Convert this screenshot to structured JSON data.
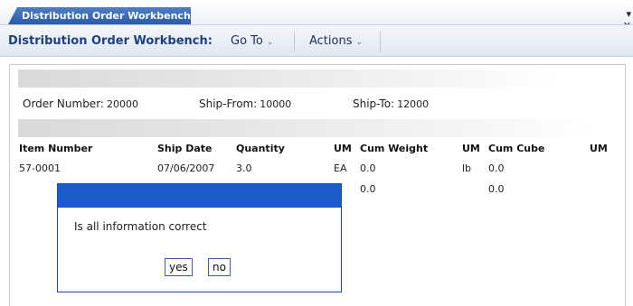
{
  "tab": {
    "label": "Distribution Order Workbench",
    "controls": "▾ ✕"
  },
  "toolbar": {
    "title": "Distribution Order Workbench:",
    "menus": [
      {
        "label": "Go To",
        "icon": "chevron-down-icon"
      },
      {
        "label": "Actions",
        "icon": "chevron-down-icon"
      }
    ]
  },
  "order": {
    "number_label": "Order Number:",
    "number_value": "20000",
    "ship_from_label": "Ship-From:",
    "ship_from_value": "10000",
    "ship_to_label": "Ship-To:",
    "ship_to_value": "12000"
  },
  "table": {
    "columns": [
      "Item Number",
      "Ship Date",
      "Quantity",
      "UM",
      "Cum Weight",
      "UM",
      "Cum Cube",
      "UM"
    ],
    "rows": [
      [
        "57-0001",
        "07/06/2007",
        "3.0",
        "EA",
        "0.0",
        "lb",
        "0.0",
        ""
      ],
      [
        "",
        "",
        "",
        "",
        "0.0",
        "",
        "0.0",
        ""
      ]
    ]
  },
  "dialog": {
    "message": "Is all information correct",
    "yes_label": "yes",
    "no_label": "no"
  },
  "colors": {
    "tab": "#2b5aa8",
    "toolbar_title": "#1f3f84",
    "dialog_bar": "#1a5bc7",
    "band": "#d9d9d9"
  }
}
